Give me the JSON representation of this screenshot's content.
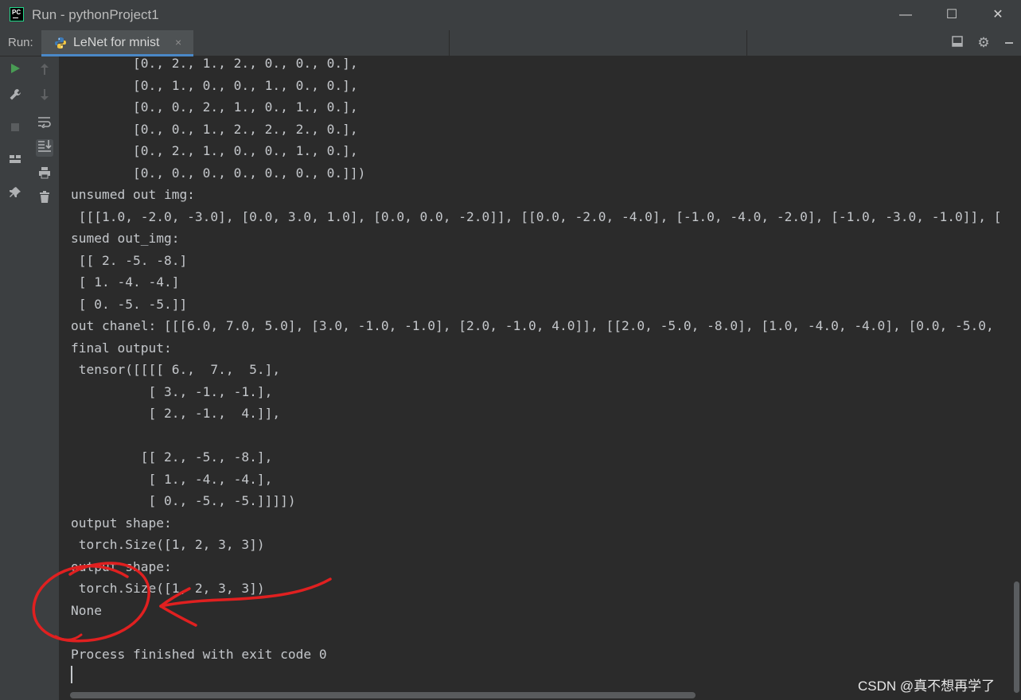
{
  "window": {
    "title": "Run - pythonProject1",
    "minimize_glyph": "—",
    "maximize_glyph": "☐",
    "close_glyph": "✕"
  },
  "run_bar": {
    "label": "Run:",
    "tab_label": "LeNet for mnist",
    "tab_close": "×",
    "tab_icon": "python-icon"
  },
  "toolbar": {
    "layout_icon": "layout-icon",
    "settings_icon": "gear-icon",
    "hide_icon": "minimize-panel-icon"
  },
  "gutter": {
    "left": [
      "run-icon",
      "wrench-icon",
      "stop-icon",
      "layout-icon",
      "pin-icon"
    ],
    "right": [
      "up-arrow-icon",
      "down-arrow-icon",
      "soft-wrap-icon",
      "scroll-to-end-icon",
      "print-icon",
      "trash-icon"
    ]
  },
  "console": {
    "lines": [
      "        [0., 2., 1., 2., 0., 0., 0.],",
      "        [0., 1., 0., 0., 1., 0., 0.],",
      "        [0., 0., 2., 1., 0., 1., 0.],",
      "        [0., 0., 1., 2., 2., 2., 0.],",
      "        [0., 2., 1., 0., 0., 1., 0.],",
      "        [0., 0., 0., 0., 0., 0., 0.]])",
      "unsumed out img:",
      " [[[1.0, -2.0, -3.0], [0.0, 3.0, 1.0], [0.0, 0.0, -2.0]], [[0.0, -2.0, -4.0], [-1.0, -4.0, -2.0], [-1.0, -3.0, -1.0]], [",
      "sumed out_img:",
      " [[ 2. -5. -8.]",
      " [ 1. -4. -4.]",
      " [ 0. -5. -5.]]",
      "out chanel: [[[6.0, 7.0, 5.0], [3.0, -1.0, -1.0], [2.0, -1.0, 4.0]], [[2.0, -5.0, -8.0], [1.0, -4.0, -4.0], [0.0, -5.0,",
      "final output:",
      " tensor([[[[ 6.,  7.,  5.],",
      "          [ 3., -1., -1.],",
      "          [ 2., -1.,  4.]],",
      "",
      "         [[ 2., -5., -8.],",
      "          [ 1., -4., -4.],",
      "          [ 0., -5., -5.]]]])",
      "output shape:",
      " torch.Size([1, 2, 3, 3])",
      "output shape:",
      " torch.Size([1, 2, 3, 3])",
      "None",
      "",
      "Process finished with exit code 0"
    ]
  },
  "watermark": "CSDN @真不想再学了",
  "annotation": {
    "color": "#e02020",
    "shapes": [
      "circle",
      "arrow"
    ]
  }
}
